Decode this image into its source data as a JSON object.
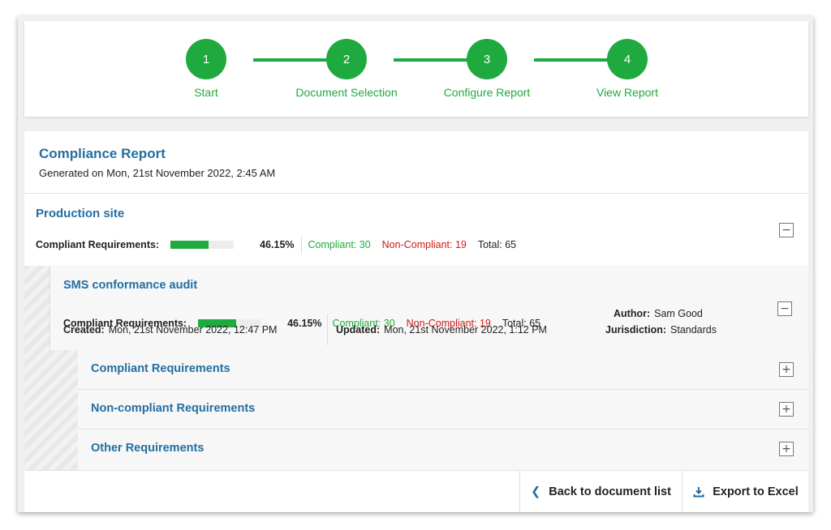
{
  "stepper": {
    "steps": [
      {
        "number": "1",
        "label": "Start"
      },
      {
        "number": "2",
        "label": "Document Selection"
      },
      {
        "number": "3",
        "label": "Configure Report"
      },
      {
        "number": "4",
        "label": "View Report"
      }
    ],
    "color": "#1faa3f"
  },
  "report": {
    "title": "Compliance Report",
    "generated": "Generated on Mon, 21st November 2022, 2:45 AM",
    "site": {
      "title": "Production site",
      "label": "Compliant Requirements:",
      "progress_fraction": 0.6,
      "percent": "46.15%",
      "compliant": "Compliant: 30",
      "non_compliant": "Non-Compliant: 19",
      "total": "Total: 65",
      "toggle": "−"
    },
    "audit": {
      "title": "SMS conformance audit",
      "label": "Compliant Requirements:",
      "progress_fraction": 0.6,
      "percent": "46.15%",
      "compliant": "Compliant: 30",
      "non_compliant": "Non-Compliant: 19",
      "total": "Total: 65",
      "author_label": "Author:",
      "author_value": "Sam Good",
      "created_label": "Created:",
      "created_value": "Mon, 21st November 2022, 12:47 PM",
      "updated_label": "Updated:",
      "updated_value": "Mon, 21st November 2022, 1:12 PM",
      "jurisdiction_label": "Jurisdiction:",
      "jurisdiction_value": "Standards",
      "toggle": "−"
    },
    "sections": [
      {
        "label": "Compliant Requirements",
        "toggle": "+"
      },
      {
        "label": "Non-compliant Requirements",
        "toggle": "+"
      },
      {
        "label": "Other Requirements",
        "toggle": "+"
      }
    ]
  },
  "footer": {
    "back_label": "Back to document list",
    "back_icon": "chevron-left-icon",
    "export_label": "Export to Excel",
    "export_icon": "download-icon"
  },
  "colors": {
    "accent_green": "#1faa3f",
    "title_blue": "#236fa1",
    "non_compliant_red": "#d01818"
  }
}
